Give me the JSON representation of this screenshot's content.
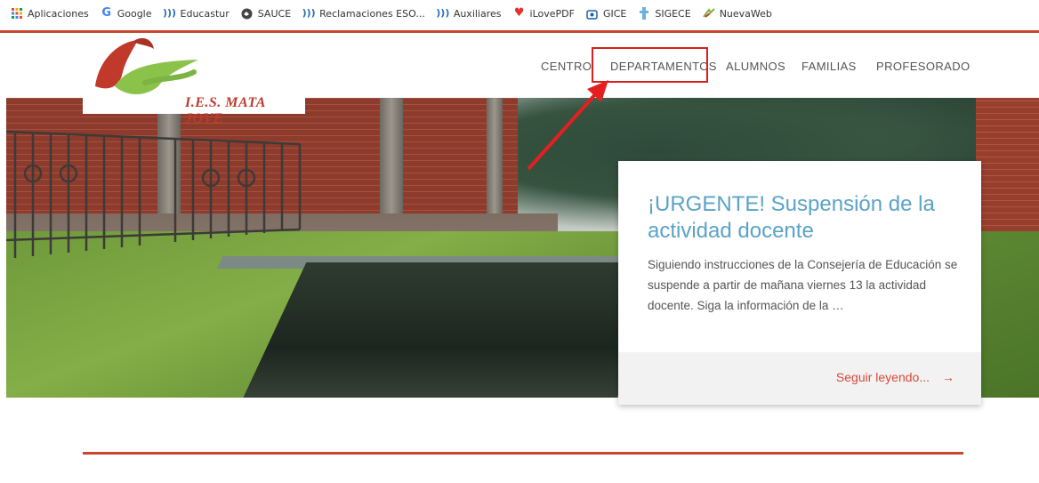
{
  "bookmarks": [
    {
      "label": "Aplicaciones",
      "icon": "apps-grid-icon"
    },
    {
      "label": "Google",
      "icon": "google-icon"
    },
    {
      "label": "Educastur",
      "icon": "educastur-icon"
    },
    {
      "label": "SAUCE",
      "icon": "sauce-icon"
    },
    {
      "label": "Reclamaciones ESO...",
      "icon": "reclamaciones-icon"
    },
    {
      "label": "Auxiliares",
      "icon": "auxiliares-icon"
    },
    {
      "label": "iLovePDF",
      "icon": "ilovepdf-icon"
    },
    {
      "label": "GICE",
      "icon": "gice-icon"
    },
    {
      "label": "SIGECE",
      "icon": "sigece-icon"
    },
    {
      "label": "NuevaWeb",
      "icon": "nuevaweb-icon"
    }
  ],
  "logo": {
    "text": "I.E.S. MATA JOVE"
  },
  "nav": [
    {
      "label": "CENTRO"
    },
    {
      "label": "DEPARTAMENTOS"
    },
    {
      "label": "ALUMNOS"
    },
    {
      "label": "FAMILIAS"
    },
    {
      "label": "PROFESORADO"
    }
  ],
  "post": {
    "title": "¡URGENTE! Suspensión de la actividad docente",
    "excerpt": "Siguiendo instrucciones de la Consejería de Educación se suspende a partir de mañana viernes 13 la actividad docente.  Siga la información de la …",
    "read_more": "Seguir leyendo...",
    "read_more_arrow": "→"
  },
  "colors": {
    "accent": "#c9452f",
    "title_blue": "#5aa3c7",
    "link_red": "#d9493a",
    "annotation_red": "#d81f1f"
  }
}
